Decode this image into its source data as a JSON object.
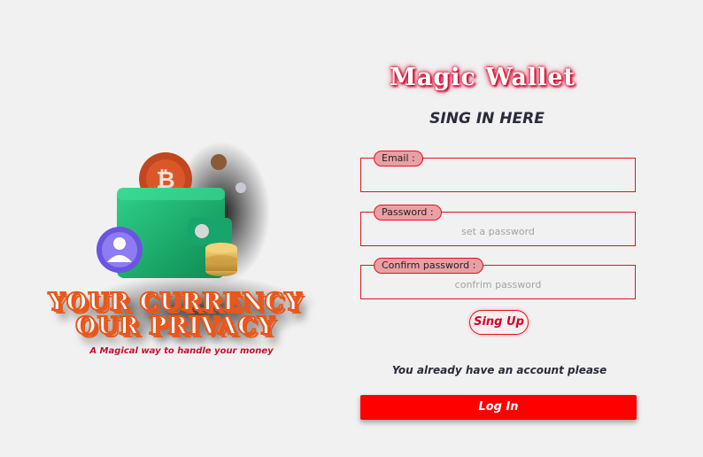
{
  "hero": {
    "slogan_line1": "YOUR CURRENCY",
    "slogan_line2": "OUR PRIVACY",
    "tagline": "A Magical way to handle your money"
  },
  "brand": {
    "title": "Magic Wallet"
  },
  "form": {
    "subtitle": "SING IN HERE",
    "email": {
      "label": "Email :",
      "placeholder": "",
      "value": ""
    },
    "password": {
      "label": "Password :",
      "placeholder": "set a password",
      "value": ""
    },
    "confirm": {
      "label": "Confirm password :",
      "placeholder": "confrim password",
      "value": ""
    },
    "signup_label": "Sing Up",
    "already_text": "You already have an account please",
    "login_label": "Log In"
  },
  "colors": {
    "accent": "#ff0000",
    "border": "#e4121f",
    "legend_bg": "#e8a0a4",
    "slogan_orange": "#e8571c",
    "wallet_green": "#1fbf7a"
  }
}
